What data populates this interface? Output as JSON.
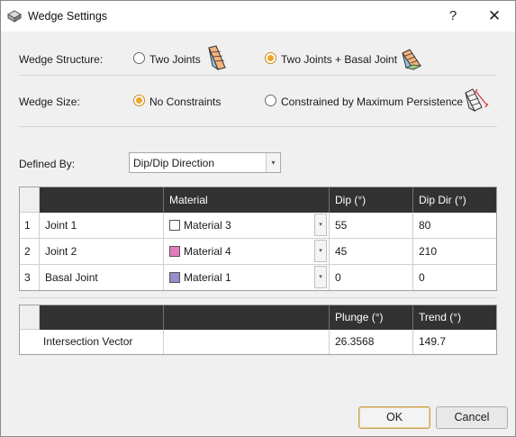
{
  "window": {
    "title": "Wedge Settings",
    "help_label": "?",
    "close_label": "✕",
    "app_icon": "wedge-app-icon"
  },
  "wedge_structure": {
    "label": "Wedge Structure:",
    "options": [
      {
        "label": "Two Joints",
        "selected": false,
        "icon": "two-joints-wedge-icon"
      },
      {
        "label": "Two Joints + Basal Joint",
        "selected": true,
        "icon": "basal-joint-wedge-icon"
      }
    ]
  },
  "wedge_size": {
    "label": "Wedge Size:",
    "options": [
      {
        "label": "No Constraints",
        "selected": true
      },
      {
        "label": "Constrained by Maximum Persistence",
        "selected": false,
        "icon": "persistence-wedge-icon"
      }
    ]
  },
  "defined_by": {
    "label": "Defined By:",
    "value": "Dip/Dip Direction",
    "arrow": "▾"
  },
  "joints_table": {
    "columns": [
      "",
      "Material",
      "Dip (°)",
      "Dip Dir (°)"
    ],
    "rows": [
      {
        "num": "1",
        "name": "Joint 1",
        "material": "Material 3",
        "swatch": "#ffffff",
        "dip": "55",
        "dipdir": "80"
      },
      {
        "num": "2",
        "name": "Joint 2",
        "material": "Material 4",
        "swatch": "#e27cbe",
        "dip": "45",
        "dipdir": "210"
      },
      {
        "num": "3",
        "name": "Basal Joint",
        "material": "Material 1",
        "swatch": "#9a8cc8",
        "dip": "0",
        "dipdir": "0"
      }
    ],
    "drop_arrow": "▾"
  },
  "intersection_table": {
    "columns": [
      "",
      "",
      "Plunge (°)",
      "Trend (°)"
    ],
    "row": {
      "name": "Intersection Vector",
      "value": "",
      "plunge": "26.3568",
      "trend": "149.7"
    }
  },
  "buttons": {
    "ok": "OK",
    "cancel": "Cancel"
  }
}
